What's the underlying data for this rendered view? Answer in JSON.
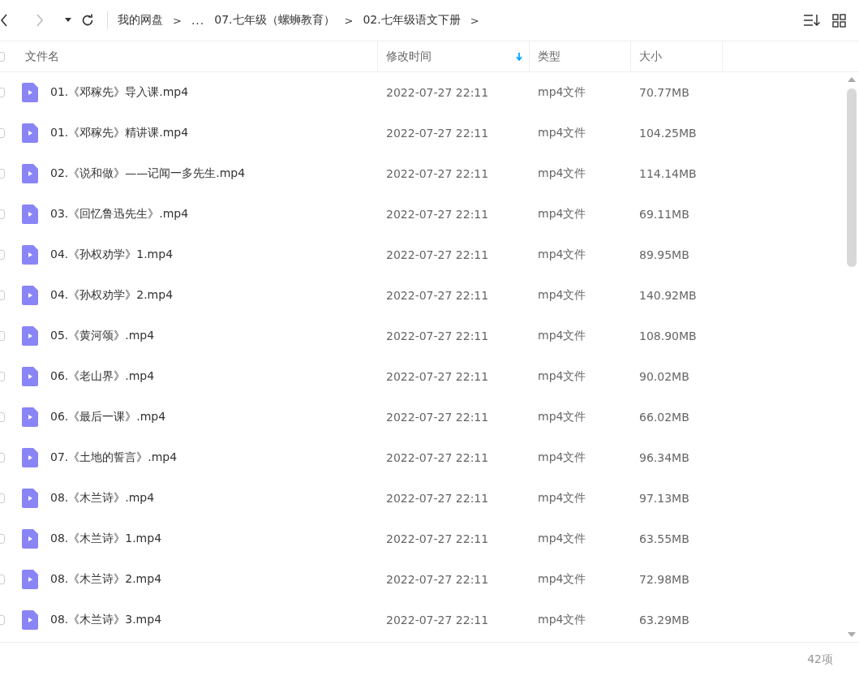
{
  "toolbar": {
    "nav": [
      {
        "kind": "back",
        "disabled": false
      },
      {
        "kind": "forward",
        "disabled": true
      },
      {
        "kind": "history",
        "disabled": false
      },
      {
        "kind": "refresh",
        "disabled": false
      }
    ],
    "breadcrumb": [
      {
        "kind": "crumb",
        "text": "我的网盘"
      },
      {
        "kind": "sep",
        "text": ">"
      },
      {
        "kind": "ellipsis",
        "text": "..."
      },
      {
        "kind": "crumb",
        "text": "07.七年级（螺蛳教育）"
      },
      {
        "kind": "sep",
        "text": ">"
      },
      {
        "kind": "crumb",
        "text": "02.七年级语文下册"
      },
      {
        "kind": "sep",
        "text": ">"
      }
    ],
    "view_buttons": [
      {
        "kind": "sort"
      },
      {
        "kind": "grid"
      }
    ]
  },
  "table": {
    "select_all": {
      "checked": false
    },
    "columns": [
      {
        "label": "文件名",
        "sorted": false
      },
      {
        "label": "修改时间",
        "sorted": true
      },
      {
        "label": "类型",
        "sorted": false
      },
      {
        "label": "大小",
        "sorted": false
      }
    ],
    "rows": [
      {
        "checked": false,
        "name": "01.《邓稼先》导入课.mp4",
        "modified": "2022-07-27 22:11",
        "type": "mp4文件",
        "size": "70.77MB"
      },
      {
        "checked": false,
        "name": "01.《邓稼先》精讲课.mp4",
        "modified": "2022-07-27 22:11",
        "type": "mp4文件",
        "size": "104.25MB"
      },
      {
        "checked": false,
        "name": "02.《说和做》——记闻一多先生.mp4",
        "modified": "2022-07-27 22:11",
        "type": "mp4文件",
        "size": "114.14MB"
      },
      {
        "checked": false,
        "name": "03.《回忆鲁迅先生》.mp4",
        "modified": "2022-07-27 22:11",
        "type": "mp4文件",
        "size": "69.11MB"
      },
      {
        "checked": false,
        "name": "04.《孙权劝学》1.mp4",
        "modified": "2022-07-27 22:11",
        "type": "mp4文件",
        "size": "89.95MB"
      },
      {
        "checked": false,
        "name": "04.《孙权劝学》2.mp4",
        "modified": "2022-07-27 22:11",
        "type": "mp4文件",
        "size": "140.92MB"
      },
      {
        "checked": false,
        "name": "05.《黄河颂》.mp4",
        "modified": "2022-07-27 22:11",
        "type": "mp4文件",
        "size": "108.90MB"
      },
      {
        "checked": false,
        "name": "06.《老山界》.mp4",
        "modified": "2022-07-27 22:11",
        "type": "mp4文件",
        "size": "90.02MB"
      },
      {
        "checked": false,
        "name": "06.《最后一课》.mp4",
        "modified": "2022-07-27 22:11",
        "type": "mp4文件",
        "size": "66.02MB"
      },
      {
        "checked": false,
        "name": "07.《土地的誓言》.mp4",
        "modified": "2022-07-27 22:11",
        "type": "mp4文件",
        "size": "96.34MB"
      },
      {
        "checked": false,
        "name": "08.《木兰诗》.mp4",
        "modified": "2022-07-27 22:11",
        "type": "mp4文件",
        "size": "97.13MB"
      },
      {
        "checked": false,
        "name": "08.《木兰诗》1.mp4",
        "modified": "2022-07-27 22:11",
        "type": "mp4文件",
        "size": "63.55MB"
      },
      {
        "checked": false,
        "name": "08.《木兰诗》2.mp4",
        "modified": "2022-07-27 22:11",
        "type": "mp4文件",
        "size": "72.98MB"
      },
      {
        "checked": false,
        "name": "08.《木兰诗》3.mp4",
        "modified": "2022-07-27 22:11",
        "type": "mp4文件",
        "size": "63.29MB"
      }
    ]
  },
  "status_bar": {
    "count": "42项"
  }
}
